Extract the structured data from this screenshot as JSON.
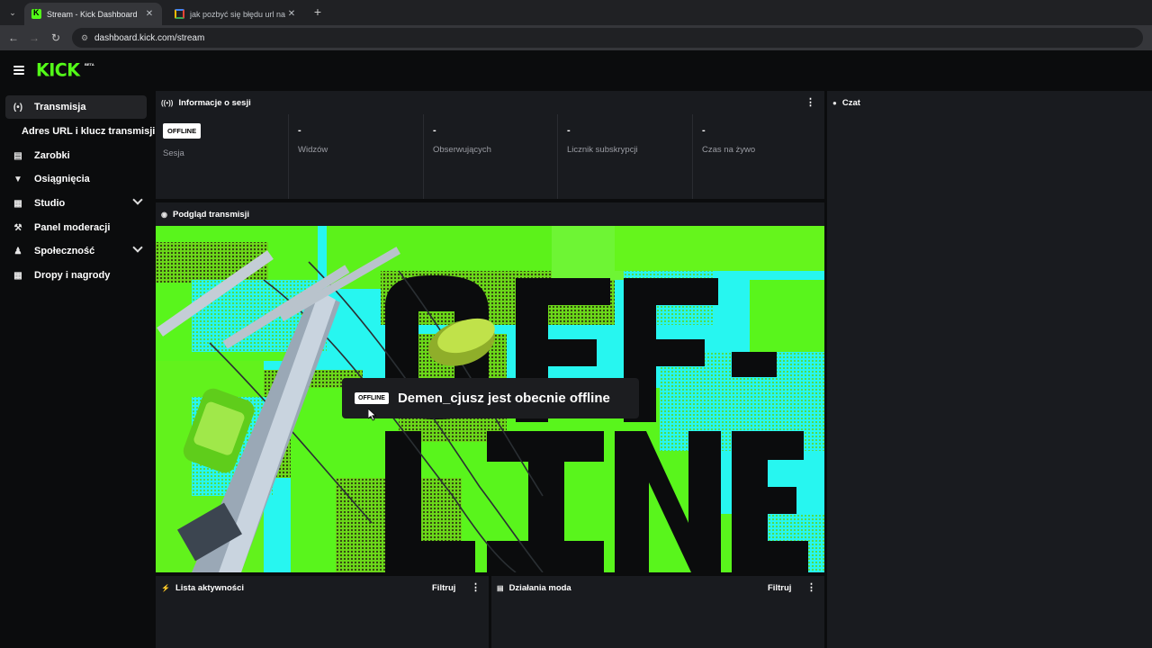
{
  "browser": {
    "tabs": [
      {
        "title": "Stream - Kick Dashboard",
        "favicon": "kick-favicon",
        "active": true
      },
      {
        "title": "jak pozbyć się błędu url na obs",
        "favicon": "google-favicon",
        "active": false
      }
    ],
    "url": "dashboard.kick.com/stream"
  },
  "header": {
    "logo": "KICK",
    "beta": "BETA"
  },
  "sidebar": {
    "items": [
      {
        "label": "Transmisja",
        "icon": "broadcast-icon",
        "active": true
      },
      {
        "label": "Adres URL i klucz transmisji",
        "sub": true
      },
      {
        "label": "Zarobki",
        "icon": "chart-icon"
      },
      {
        "label": "Osiągnięcia",
        "icon": "trophy-icon"
      },
      {
        "label": "Studio",
        "icon": "film-icon",
        "expandable": true
      },
      {
        "label": "Panel moderacji",
        "icon": "wrench-icon"
      },
      {
        "label": "Społeczność",
        "icon": "people-icon",
        "expandable": true
      },
      {
        "label": "Dropy i nagrody",
        "icon": "gift-icon"
      }
    ]
  },
  "session": {
    "title": "Informacje o sesji",
    "status_badge": "OFFLINE",
    "session_label": "Sesja",
    "stats": [
      {
        "value": "-",
        "label": "Widzów"
      },
      {
        "value": "-",
        "label": "Obserwujących"
      },
      {
        "value": "-",
        "label": "Licznik subskrypcji"
      },
      {
        "value": "-",
        "label": "Czas na żywo"
      }
    ]
  },
  "preview": {
    "title": "Podgląd transmisji",
    "overlay_text": "OFF- LINE",
    "badge": "OFFLINE",
    "message": "Demen_cjusz jest obecnie offline"
  },
  "chat": {
    "title": "Czat"
  },
  "activity": {
    "title": "Lista aktywności",
    "filter": "Filtruj"
  },
  "mod_actions": {
    "title": "Działania moda",
    "filter": "Filtruj"
  },
  "colors": {
    "accent": "#53fc18",
    "background": "#0b0c0d",
    "panel": "#191b1f"
  }
}
